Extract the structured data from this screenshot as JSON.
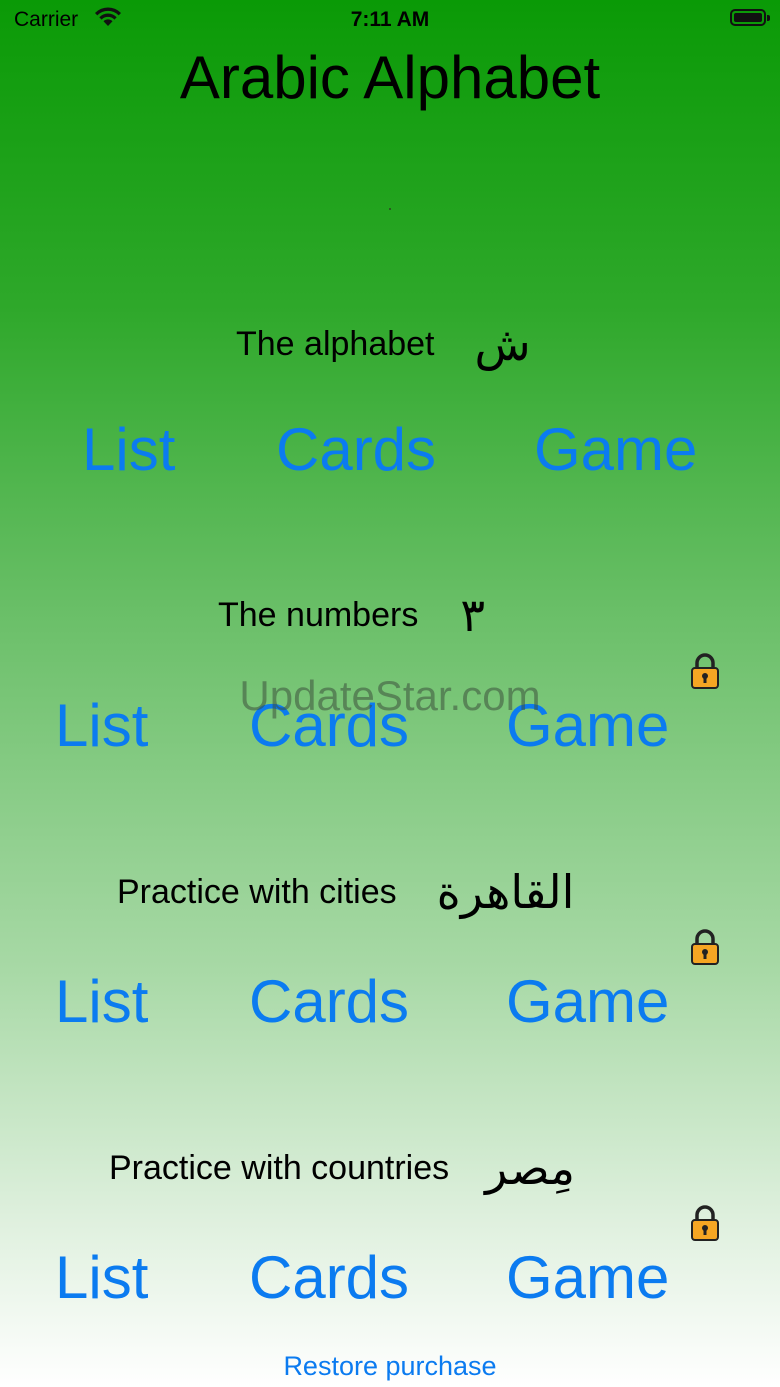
{
  "status_bar": {
    "carrier": "Carrier",
    "time": "7:11 AM"
  },
  "app_title": "Arabic Alphabet",
  "sections": [
    {
      "title": "The alphabet",
      "arabic": "ش",
      "list": "List",
      "cards": "Cards",
      "game": "Game",
      "locked": false
    },
    {
      "title": "The numbers",
      "arabic": "٣",
      "list": "List",
      "cards": "Cards",
      "game": "Game",
      "locked": true
    },
    {
      "title": "Practice with cities",
      "arabic": "القاهرة",
      "list": "List",
      "cards": "Cards",
      "game": "Game",
      "locked": true
    },
    {
      "title": "Practice with countries",
      "arabic": "مِصر",
      "list": "List",
      "cards": "Cards",
      "game": "Game",
      "locked": true
    }
  ],
  "watermark": "UpdateStar.com",
  "restore_label": "Restore purchase",
  "colors": {
    "accent": "#0b7bf0",
    "gradient_top": "#0a9a06",
    "gradient_bottom": "#ffffff",
    "lock": "#f5a623"
  }
}
